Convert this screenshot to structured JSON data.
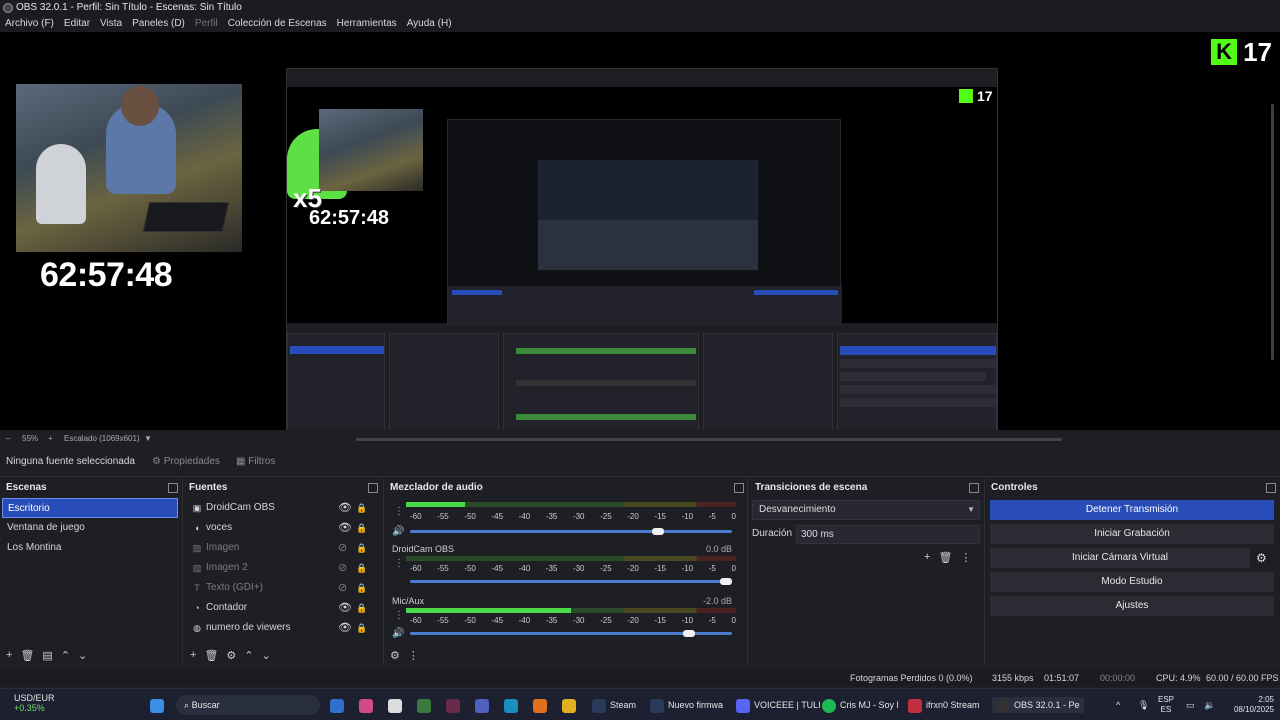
{
  "window": {
    "title": "OBS 32.0.1 - Perfil: Sin Título - Escenas: Sin Título"
  },
  "menu": [
    "Archivo (F)",
    "Editar",
    "Vista",
    "Paneles (D)",
    "Perfil",
    "Colección de Escenas",
    "Herramientas",
    "Ayuda (H)"
  ],
  "preview": {
    "timer": "62:57:48",
    "viewers": "17",
    "overlay_multiplier": "x5",
    "zoom": "55%",
    "scaling": "Escalado (1069x601)"
  },
  "source_bar": {
    "no_selection": "Ninguna fuente seleccionada",
    "properties": "Propiedades",
    "filters": "Filtros"
  },
  "scenes": {
    "title": "Escenas",
    "items": [
      "Escritorio",
      "Ventana de juego",
      "Los Montina"
    ],
    "selected": 0
  },
  "sources": {
    "title": "Fuentes",
    "items": [
      {
        "label": "DroidCam OBS",
        "icon": "camera-icon",
        "visible": true
      },
      {
        "label": "voces",
        "icon": "speaker-icon",
        "visible": true
      },
      {
        "label": "Imagen",
        "icon": "image-icon",
        "visible": false
      },
      {
        "label": "Imagen 2",
        "icon": "image-icon",
        "visible": false
      },
      {
        "label": "Texto (GDI+)",
        "icon": "text-icon",
        "visible": false
      },
      {
        "label": "Contador",
        "icon": "clock-icon",
        "visible": true
      },
      {
        "label": "numero de viewers",
        "icon": "globe-icon",
        "visible": true
      }
    ]
  },
  "mixer": {
    "title": "Mezclador de audio",
    "ticks": [
      "-60",
      "-55",
      "-50",
      "-45",
      "-40",
      "-35",
      "-30",
      "-25",
      "-20",
      "-15",
      "-10",
      "-5",
      "0"
    ],
    "channels": [
      {
        "name": "",
        "db": "",
        "level": 0.18,
        "fader": 0.78
      },
      {
        "name": "DroidCam OBS",
        "db": "0.0 dB",
        "level": 0.0,
        "fader": 1.0
      },
      {
        "name": "Mic/Aux",
        "db": "-2.0 dB",
        "level": 0.5,
        "fader": 0.88
      }
    ]
  },
  "transitions": {
    "title": "Transiciones de escena",
    "selected": "Desvanecimiento",
    "duration_label": "Duración",
    "duration_value": "300 ms"
  },
  "controls": {
    "title": "Controles",
    "buttons": [
      "Detener Transmisión",
      "Iniciar Grabación",
      "Iniciar Cámara Virtual",
      "Modo Estudio",
      "Ajustes"
    ]
  },
  "status": {
    "dropped": "Fotogramas Perdidos 0 (0.0%)",
    "bitrate": "3155 kbps",
    "stream_time": "01:51:07",
    "rec_time": "00:00:00",
    "cpu": "CPU: 4.9%",
    "fps": "60.00 / 60.00 FPS"
  },
  "taskbar": {
    "ticker_name": "USD/EUR",
    "ticker_change": "+0.35%",
    "search": "Buscar",
    "apps": [
      "Steam",
      "Nuevo firmwa",
      "VOICEEE | TULI",
      "Cris MJ - Soy l",
      "ifrxn0 Stream",
      "OBS 32.0.1 - Pe"
    ],
    "lang": "ESP",
    "lang2": "ES",
    "time": "2:05",
    "date": "08/10/2025"
  },
  "colors": {
    "accent": "#284cb8",
    "kick_green": "#53fc18",
    "meter_green": "#4ad94a"
  }
}
